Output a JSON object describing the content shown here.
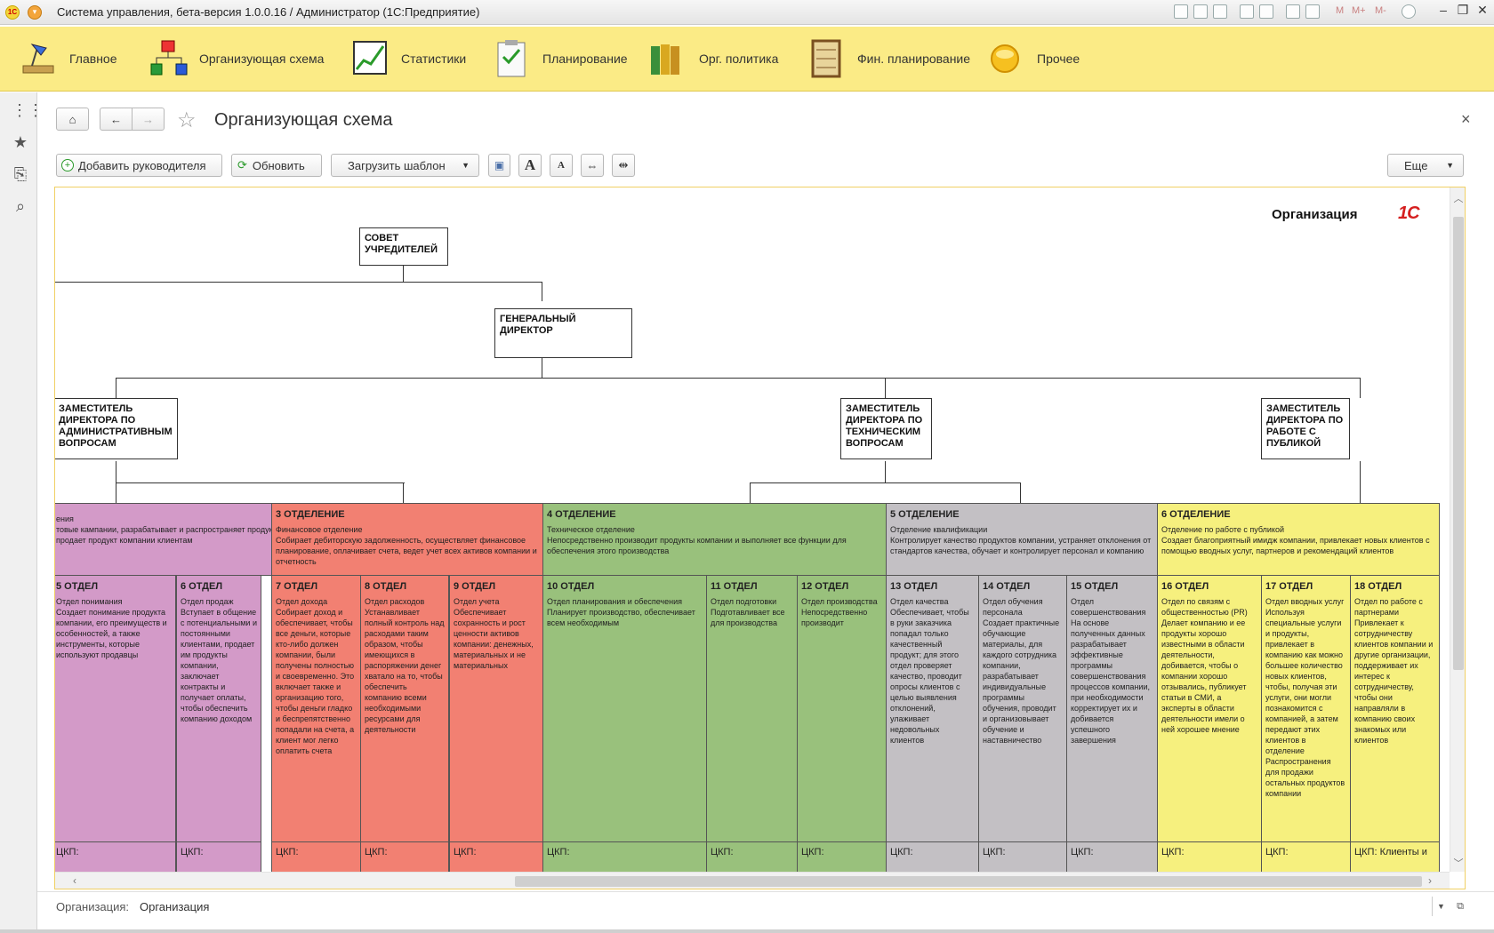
{
  "window": {
    "title": "Система управления, бета-версия 1.0.0.16 / Администратор  (1С:Предприятие)",
    "toolbar_m_labels": [
      "M",
      "M+",
      "M-"
    ]
  },
  "sections": [
    {
      "label": "Главное",
      "icon": "desk-lamp-icon"
    },
    {
      "label": "Организующая схема",
      "icon": "org-chart-icon"
    },
    {
      "label": "Статистики",
      "icon": "line-chart-icon"
    },
    {
      "label": "Планирование",
      "icon": "clipboard-icon"
    },
    {
      "label": "Орг. политика",
      "icon": "binders-icon"
    },
    {
      "label": "Фин. планирование",
      "icon": "abacus-icon"
    },
    {
      "label": "Прочее",
      "icon": "yellow-circle-icon"
    }
  ],
  "page": {
    "title": "Организующая схема",
    "close": "×"
  },
  "commands": {
    "add_manager": "Добавить руководителя",
    "refresh": "Обновить",
    "load_template": "Загрузить шаблон",
    "more": "Еще"
  },
  "chart": {
    "org_label": "Организация",
    "brand": "1С",
    "council": "СОВЕТ УЧРЕДИТЕЛЕЙ",
    "ceo": "ГЕНЕРАЛЬНЫЙ ДИРЕКТОР",
    "deputies": [
      "ЗАМЕСТИТЕЛЬ ДИРЕКТОРА ПО АДМИНИСТРАТИВНЫМ ВОПРОСАМ",
      "ЗАМЕСТИТЕЛЬ ДИРЕКТОРА ПО ТЕХНИЧЕСКИМ ВОПРОСАМ",
      "ЗАМЕСТИТЕЛЬ ДИРЕКТОРА ПО РАБОТЕ С ПУБЛИКОЙ"
    ],
    "departments": [
      {
        "title": "",
        "subtitle": "ения",
        "desc": "товые кампании, разрабатывает и распространяет продукции/услуг, продает продукт компании клиентам",
        "color": "#d39ac8"
      },
      {
        "title": "3 ОТДЕЛЕНИЕ",
        "subtitle": "Финансовое отделение",
        "desc": "Собирает дебиторскую задолженность, осуществляет финансовое планирование, оплачивает счета, ведет учет всех активов компании и отчетность",
        "color": "#f28072"
      },
      {
        "title": "4 ОТДЕЛЕНИЕ",
        "subtitle": "Техническое отделение",
        "desc": "Непосредственно производит продукты компании и выполняет все функции для обеспечения этого производства",
        "color": "#99c17c"
      },
      {
        "title": "5 ОТДЕЛЕНИЕ",
        "subtitle": "Отделение квалификации",
        "desc": "Контролирует качество продуктов компании, устраняет отклонения от стандартов качества, обучает и контролирует персонал и компанию",
        "color": "#c3c0c4"
      },
      {
        "title": "6 ОТДЕЛЕНИЕ",
        "subtitle": "Отделение по работе с публикой",
        "desc": "Создает благоприятный имидж компании, привлекает новых клиентов с помощью вводных услуг, партнеров и рекомендаций клиентов",
        "color": "#f6f07e"
      }
    ],
    "otdels": [
      {
        "title": "5 ОТДЕЛ",
        "body": "Отдел понимания\nСоздает понимание продукта компании, его преимуществ и особенностей, а также инструменты, которые используют продавцы",
        "ckp": "ЦКП:"
      },
      {
        "title": "6 ОТДЕЛ",
        "body": "Отдел продаж\nВступает в общение с потенциальными и постоянными клиентами, продает им продукты компании, заключает контракты и получает оплаты, чтобы обеспечить компанию доходом",
        "ckp": "ЦКП:"
      },
      {
        "title": "7 ОТДЕЛ",
        "body": "Отдел дохода\nСобирает доход и обеспечивает, чтобы все деньги, которые кто-либо должен компании, были получены полностью и своевременно. Это включает также и организацию того, чтобы деньги гладко и беспрепятственно попадали на счета, а клиент мог легко оплатить счета",
        "ckp": "ЦКП:"
      },
      {
        "title": "8 ОТДЕЛ",
        "body": "Отдел расходов\nУстанавливает полный контроль над расходами таким образом, чтобы имеющихся в распоряжении денег хватало на то, чтобы обеспечить компанию всеми необходимыми ресурсами для деятельности",
        "ckp": "ЦКП:"
      },
      {
        "title": "9 ОТДЕЛ",
        "body": "Отдел учета\nОбеспечивает сохранность и рост ценности активов компании: денежных, материальных и не материальных",
        "ckp": "ЦКП:"
      },
      {
        "title": "10 ОТДЕЛ",
        "body": "Отдел планирования и обеспечения\nПланирует производство, обеспечивает всем необходимым",
        "ckp": "ЦКП:"
      },
      {
        "title": "11 ОТДЕЛ",
        "body": "Отдел подготовки\nПодготавливает все для производства",
        "ckp": "ЦКП:"
      },
      {
        "title": "12 ОТДЕЛ",
        "body": "Отдел производства\nНепосредственно производит",
        "ckp": "ЦКП:"
      },
      {
        "title": "13 ОТДЕЛ",
        "body": "Отдел качества\nОбеспечивает, чтобы в руки заказчика попадал только качественный продукт; для этого отдел проверяет качество, проводит опросы клиентов с целью выявления отклонений, улаживает недовольных клиентов",
        "ckp": "ЦКП:"
      },
      {
        "title": "14 ОТДЕЛ",
        "body": "Отдел обучения персонала\nСоздает практичные обучающие материалы, для каждого сотрудника компании, разрабатывает индивидуальные программы обучения, проводит и организовывает обучение и наставничество",
        "ckp": "ЦКП:"
      },
      {
        "title": "15 ОТДЕЛ",
        "body": "Отдел совершенствования\nНа основе полученных данных разрабатывает эффективные программы совершенствования процессов компании, при необходимости корректирует их и добивается успешного завершения",
        "ckp": "ЦКП:"
      },
      {
        "title": "16 ОТДЕЛ",
        "body": "Отдел по связям с общественностью (PR)\nДелает компанию и ее продукты хорошо известными в области деятельности, добивается, чтобы о компании хорошо отзывались, публикует статьи в СМИ, а эксперты в области деятельности имели о ней хорошее мнение",
        "ckp": "ЦКП:"
      },
      {
        "title": "17 ОТДЕЛ",
        "body": "Отдел вводных услуг\nИспользуя специальные услуги и продукты, привлекает в компанию как можно большее количество новых клиентов, чтобы, получая эти услуги, они могли познакомится с компанией, а затем передают этих клиентов в отделение Распространения для продажи остальных продуктов компании",
        "ckp": "ЦКП:"
      },
      {
        "title": "18 ОТДЕЛ",
        "body": "Отдел по работе с партнерами\nПривлекает к сотрудничеству клиентов компании и другие организации, поддерживает их интерес к сотрудничеству, чтобы они направляли в компанию своих знакомых или клиентов",
        "ckp": "ЦКП: Клиенты и"
      }
    ]
  },
  "footer": {
    "label": "Организация:",
    "value": "Организация"
  },
  "colors": {
    "sections_bg": "#fbeb86",
    "accent_frame": "#f0d064"
  }
}
